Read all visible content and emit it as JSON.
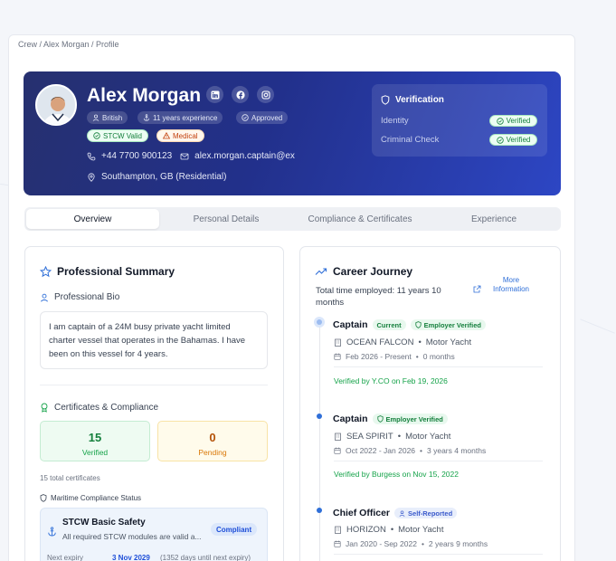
{
  "breadcrumb": "Crew / Alex Morgan / Profile",
  "profile": {
    "name": "Alex Morgan",
    "nationality": "British",
    "experience": "11 years experience",
    "status": "Approved",
    "stcw": "STCW Valid",
    "medical": "Medical",
    "phone": "+44 7700 900123",
    "email": "alex.morgan.captain@ex",
    "location": "Southampton, GB (Residential)"
  },
  "verification": {
    "title": "Verification",
    "items": [
      {
        "label": "Identity",
        "status": "Verified"
      },
      {
        "label": "Criminal Check",
        "status": "Verified"
      }
    ]
  },
  "tabs": [
    "Overview",
    "Personal Details",
    "Compliance & Certificates",
    "Experience"
  ],
  "summary": {
    "title": "Professional Summary",
    "bio_label": "Professional Bio",
    "bio": "I am captain of a 24M busy private yacht limited charter vessel that operates in the Bahamas. I have been on this vessel for 4 years.",
    "cert_title": "Certificates & Compliance",
    "verified_count": "15",
    "verified_label": "Verified",
    "pending_count": "0",
    "pending_label": "Pending",
    "total": "15 total certificates",
    "maritime_label": "Maritime Compliance Status",
    "stcw_title": "STCW Basic Safety",
    "stcw_desc": "All required STCW modules are valid a...",
    "stcw_badge": "Compliant",
    "next_label": "Next expiry",
    "next_date": "3 Nov 2029",
    "next_days": "(1352 days until next expiry)"
  },
  "career": {
    "title": "Career Journey",
    "total": "Total time employed: 11 years 10 months",
    "more": "More Information",
    "jobs": [
      {
        "role": "Captain",
        "badge1": "Current",
        "badge2": "Employer Verified",
        "vessel": "OCEAN FALCON",
        "type": "Motor Yacht",
        "dates": "Feb 2026 - Present",
        "duration": "0 months",
        "verified": "Verified by Y.CO on Feb 19, 2026"
      },
      {
        "role": "Captain",
        "badge2": "Employer Verified",
        "vessel": "SEA SPIRIT",
        "type": "Motor Yacht",
        "dates": "Oct 2022 - Jan 2026",
        "duration": "3 years 4 months",
        "verified": "Verified by Burgess on Nov 15, 2022"
      },
      {
        "role": "Chief Officer",
        "badge2": "Self-Reported",
        "vessel": "HORIZON",
        "type": "Motor Yacht",
        "dates": "Jan 2020 - Sep 2022",
        "duration": "2 years 9 months"
      }
    ]
  },
  "colors": {
    "hero_start": "#26306f",
    "hero_end": "#2d46c4",
    "verified_green": "#15803d",
    "pending_orange": "#c2410c",
    "accent_blue": "#2f6fd8"
  }
}
